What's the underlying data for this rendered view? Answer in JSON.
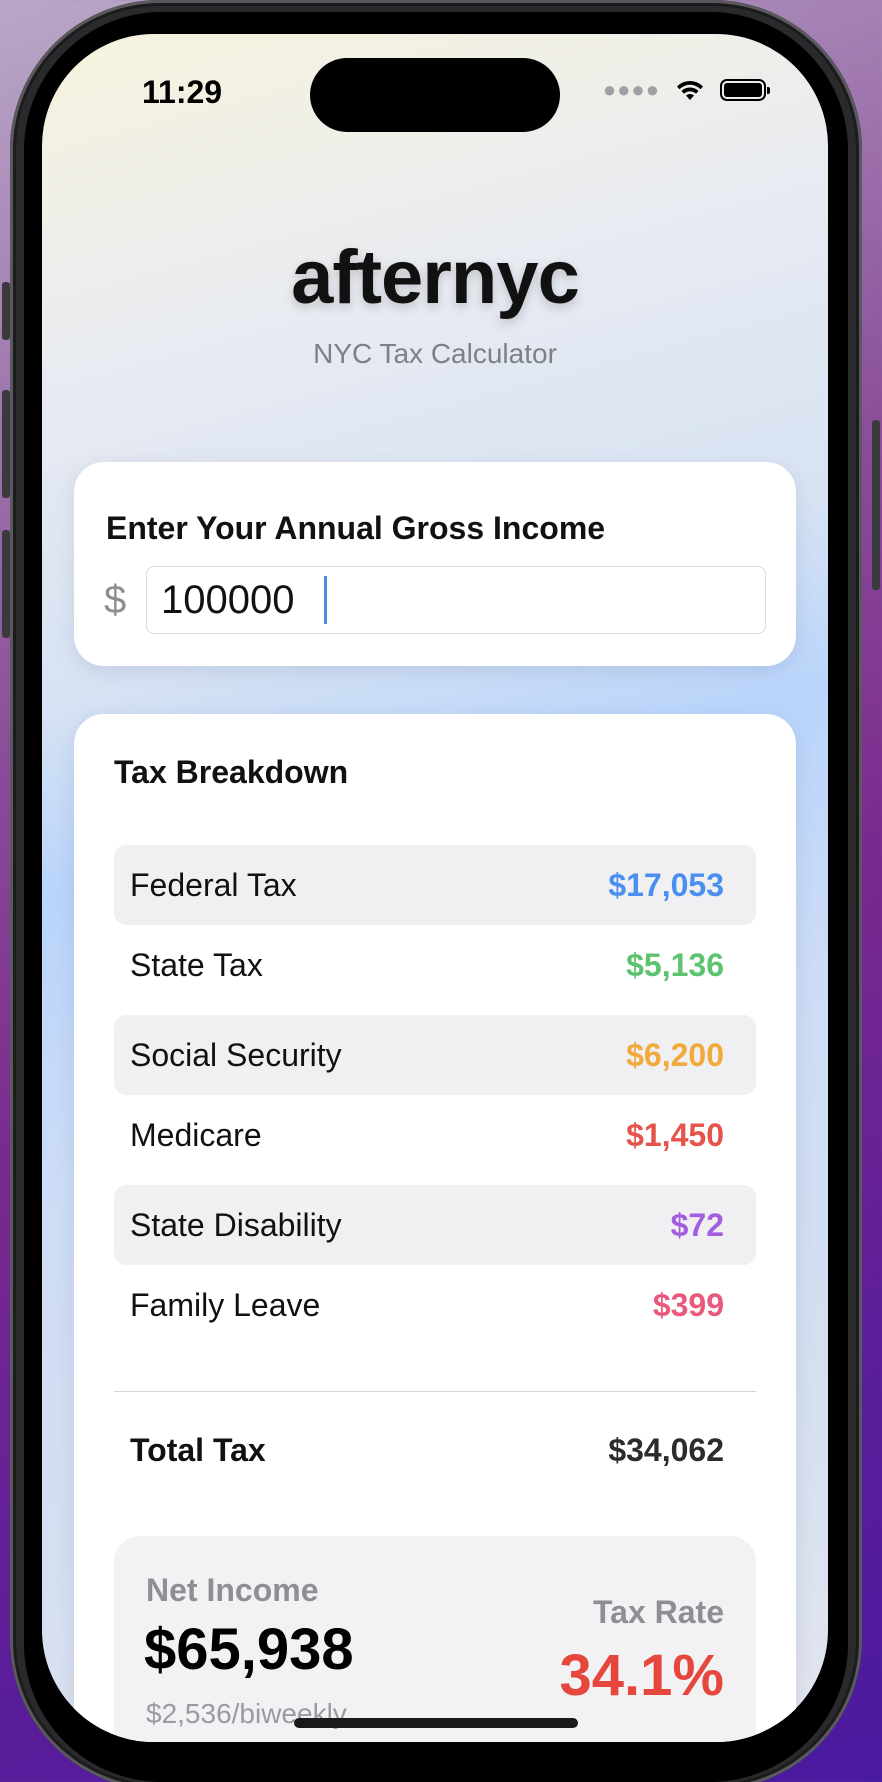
{
  "status_bar": {
    "time": "11:29",
    "signal_icon": "cellular-dots-icon",
    "wifi_icon": "wifi-icon",
    "battery_icon": "battery-icon"
  },
  "header": {
    "title": "afternyc",
    "subtitle": "NYC Tax Calculator"
  },
  "income": {
    "label": "Enter Your Annual Gross Income",
    "currency_symbol": "$",
    "value": "100000"
  },
  "breakdown": {
    "title": "Tax Breakdown",
    "items": [
      {
        "label": "Federal Tax",
        "value": "$17,053",
        "color": "#4a8ff0"
      },
      {
        "label": "State Tax",
        "value": "$5,136",
        "color": "#5cc36e"
      },
      {
        "label": "Social Security",
        "value": "$6,200",
        "color": "#f0a93a"
      },
      {
        "label": "Medicare",
        "value": "$1,450",
        "color": "#e5534b"
      },
      {
        "label": "State Disability",
        "value": "$72",
        "color": "#a35de0"
      },
      {
        "label": "Family Leave",
        "value": "$399",
        "color": "#e8597c"
      }
    ],
    "total_label": "Total Tax",
    "total_value": "$34,062"
  },
  "summary": {
    "net_label": "Net Income",
    "net_value": "$65,938",
    "net_biweekly": "$2,536/biweekly",
    "rate_label": "Tax Rate",
    "rate_value": "34.1%",
    "rate_color": "#e5473d"
  }
}
